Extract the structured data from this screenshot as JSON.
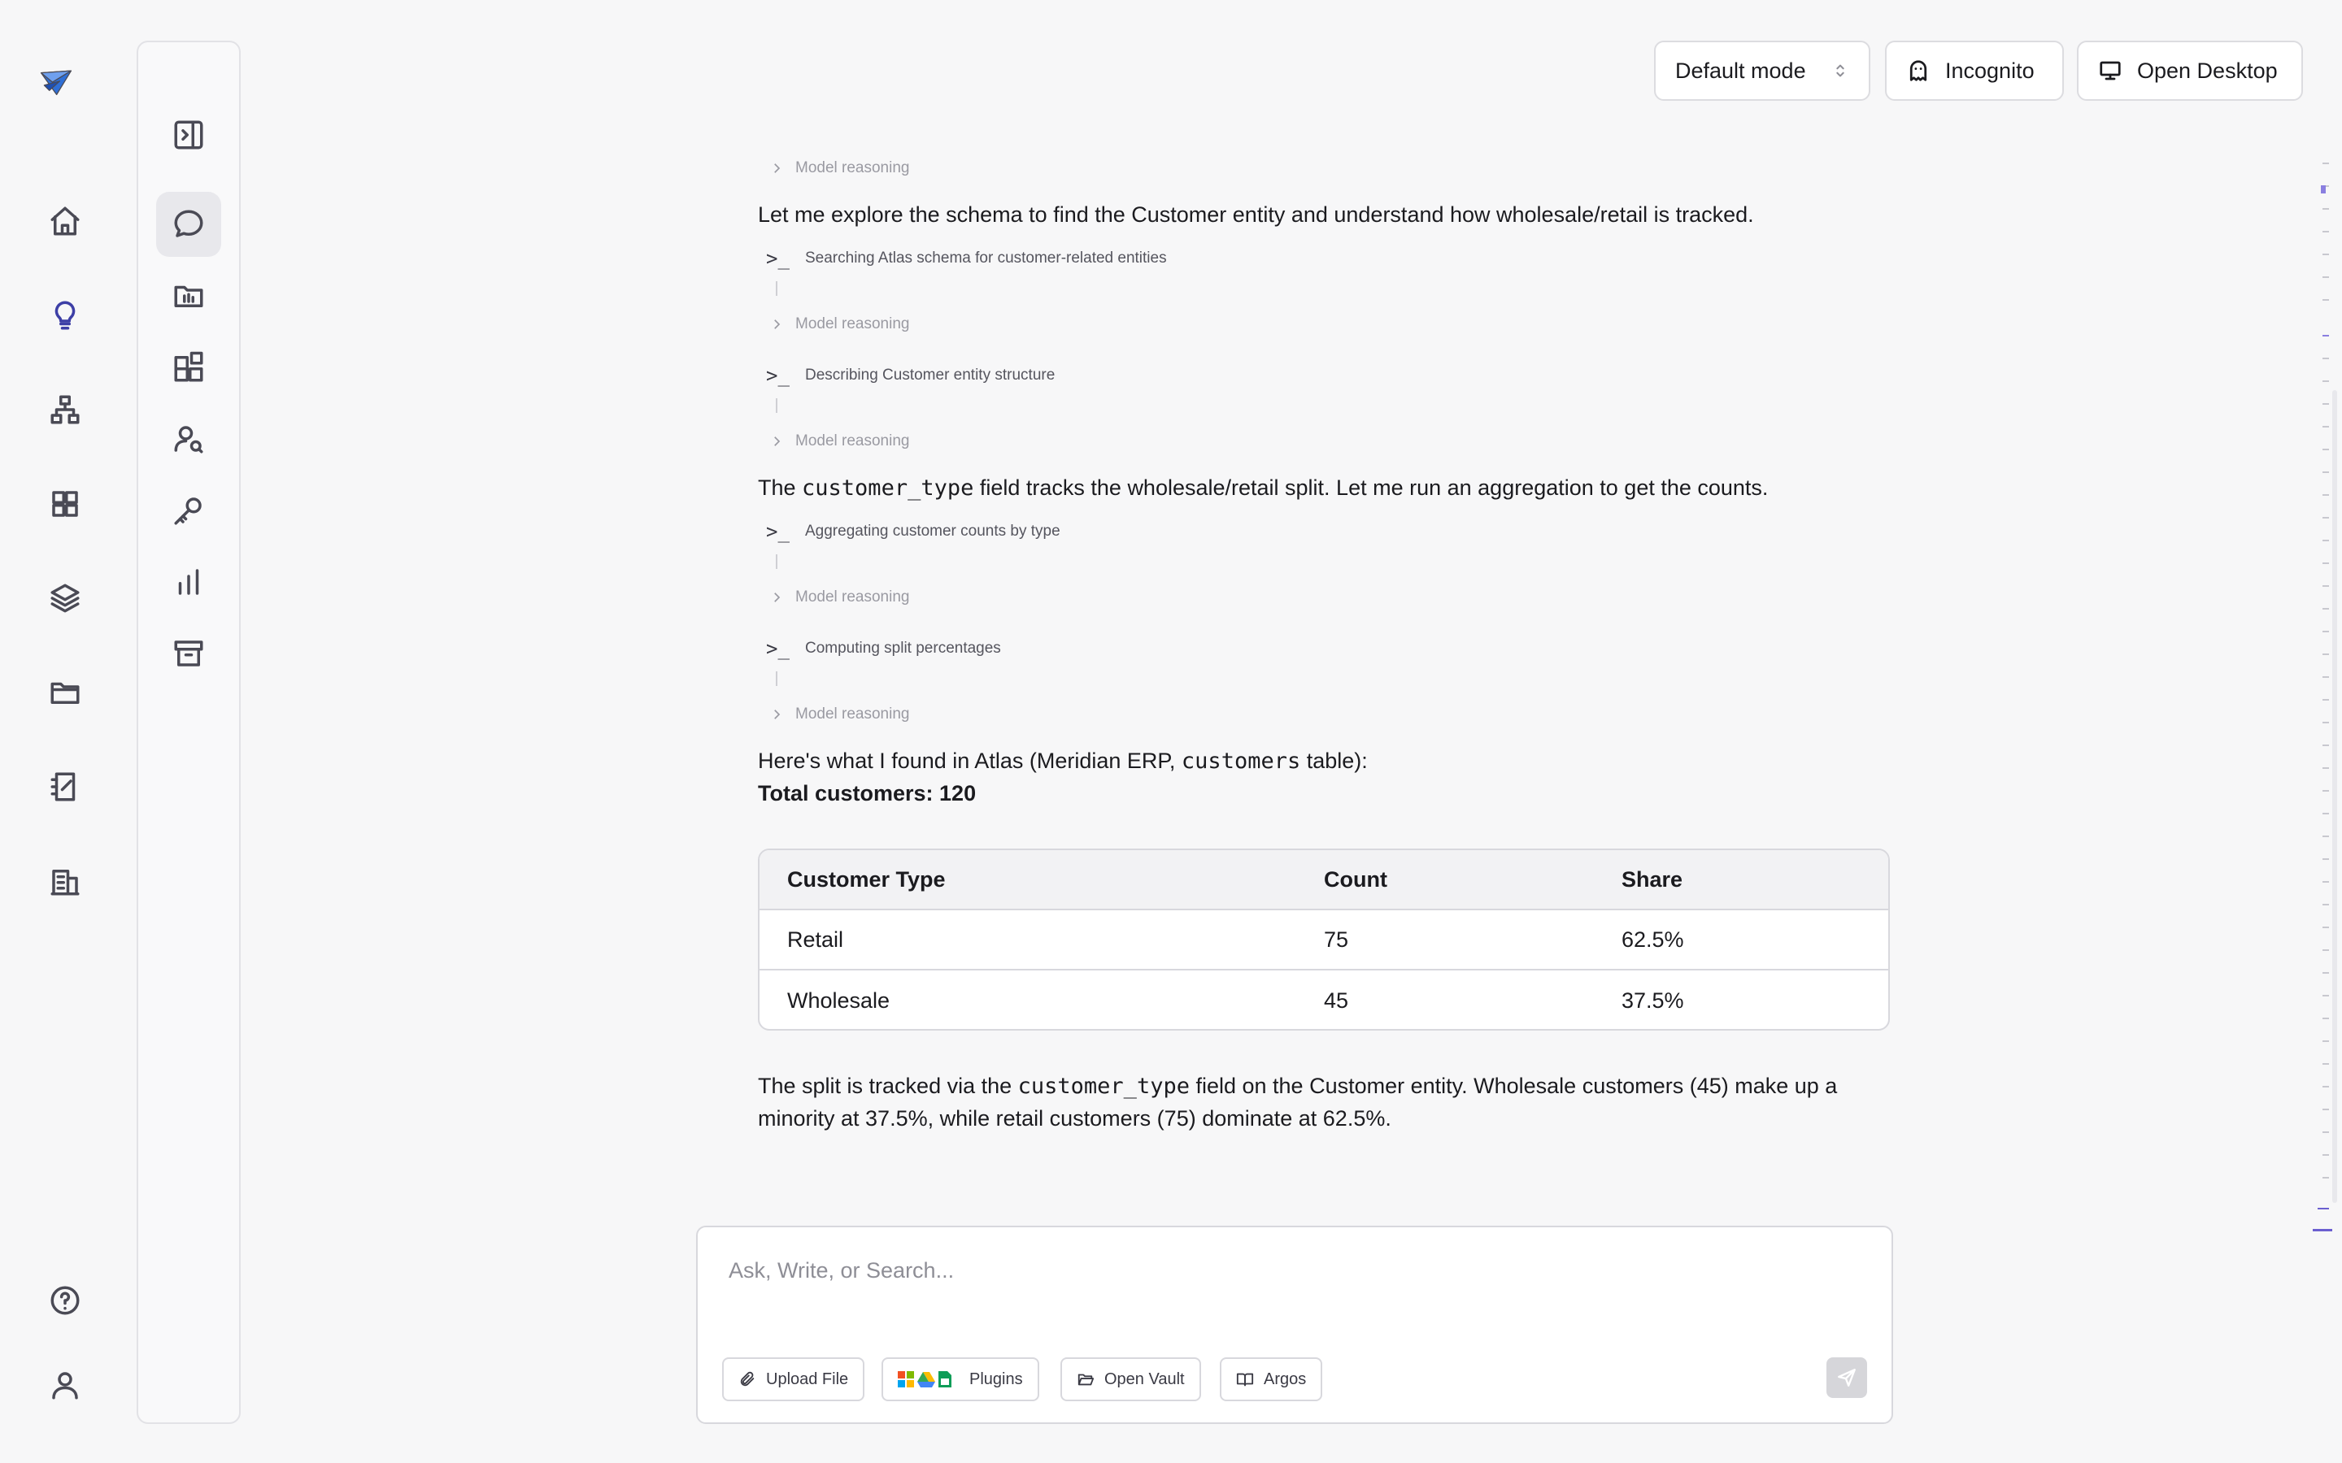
{
  "header": {
    "mode_label": "Default mode",
    "incognito_label": "Incognito",
    "open_desktop_label": "Open Desktop"
  },
  "rail": {
    "items": [
      "home-icon",
      "lightbulb-icon",
      "org-chart-icon",
      "grid-icon",
      "layers-icon",
      "folder-icon",
      "notebook-icon",
      "building-icon",
      "help-icon",
      "user-icon"
    ],
    "active": "lightbulb-icon",
    "accent_color": "#3d3fa6"
  },
  "panel": {
    "items": [
      "toggle-sidebar-icon",
      "chat-icon",
      "project-folder-icon",
      "widgets-icon",
      "user-search-icon",
      "key-icon",
      "bar-chart-icon",
      "archive-icon"
    ],
    "selected": "chat-icon"
  },
  "conversation": {
    "reasoning_label": "Model reasoning",
    "msg1": "Let me explore the schema to find the Customer entity and understand how wholesale/retail is tracked.",
    "tool1": "Searching Atlas schema for customer-related entities",
    "tool2": "Describing Customer entity structure",
    "msg2_pre": "The ",
    "msg2_code": "customer_type",
    "msg2_post": " field tracks the wholesale/retail split. Let me run an aggregation to get the counts.",
    "tool3": "Aggregating customer counts by type",
    "tool4": "Computing split percentages",
    "prompt_symbol": ">_",
    "result_pre": "Here's what I found in Atlas (Meridian ERP, ",
    "result_code": "customers",
    "result_post": " table):",
    "total": "Total customers: 120",
    "table": {
      "headers": [
        "Customer Type",
        "Count",
        "Share"
      ],
      "rows": [
        [
          "Retail",
          "75",
          "62.5%"
        ],
        [
          "Wholesale",
          "45",
          "37.5%"
        ]
      ]
    },
    "summary_pre": "The split is tracked via the ",
    "summary_code": "customer_type",
    "summary_line1_post": " field on the Customer entity. Wholesale customers (45) make up a",
    "summary_line2": "minority at 37.5%, while retail customers (75) dominate at 62.5%."
  },
  "composer": {
    "placeholder": "Ask, Write, or Search...",
    "upload_label": "Upload File",
    "plugins_label": "Plugins",
    "vault_label": "Open Vault",
    "argos_label": "Argos"
  }
}
